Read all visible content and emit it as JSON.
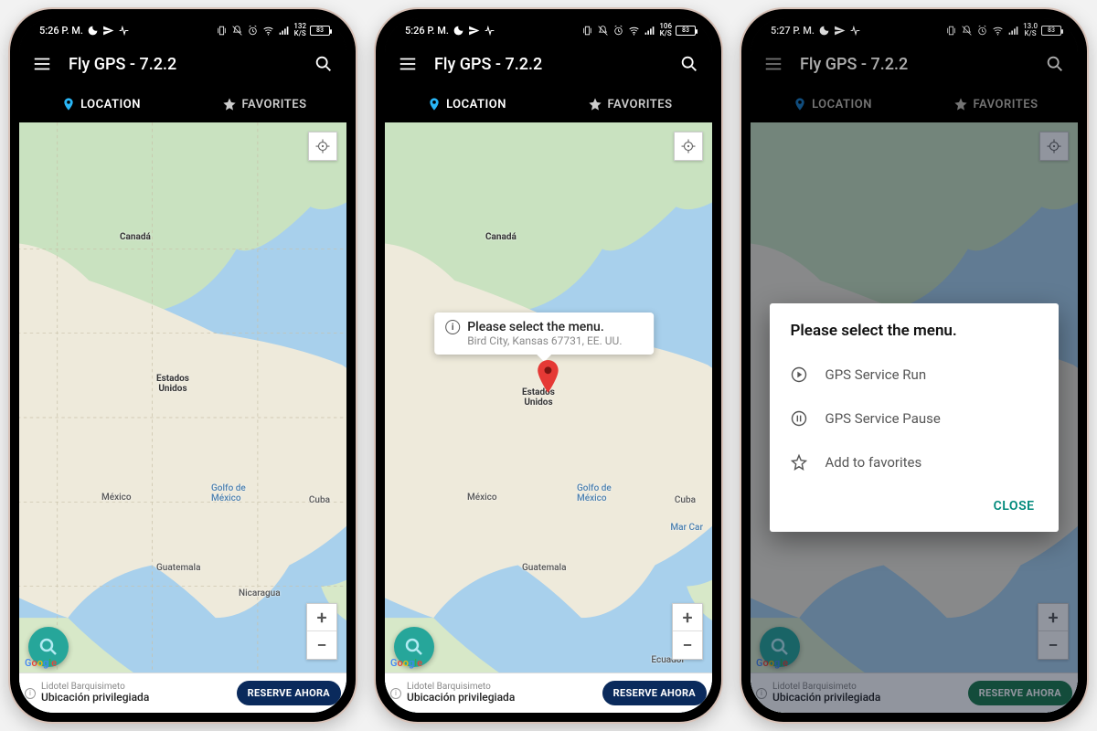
{
  "status": {
    "time_a": "5:26 P. M.",
    "time_b": "5:26 P. M.",
    "time_c": "5:27 P. M.",
    "net_a": "132",
    "net_b": "106",
    "net_c": "13.0",
    "net_unit": "K/S",
    "battery": "83"
  },
  "app": {
    "title": "Fly GPS - 7.2.2"
  },
  "tabs": {
    "location": "LOCATION",
    "favorites": "FAVORITES"
  },
  "mapLabels": {
    "canada": "Canadá",
    "usa": "Estados\nUnidos",
    "mexico": "México",
    "golfo": "Golfo de\nMéxico",
    "cuba": "Cuba",
    "guatemala": "Guatemala",
    "nicaragua": "Nicaragua",
    "ecuador": "Ecuador",
    "marcar": "Mar Car"
  },
  "tooltip": {
    "title": "Please select the menu.",
    "subtitle": "Bird City, Kansas 67731, EE. UU."
  },
  "dialog": {
    "title": "Please select the menu.",
    "opt1": "GPS Service Run",
    "opt2": "GPS Service Pause",
    "opt3": "Add to favorites",
    "close": "CLOSE"
  },
  "ad": {
    "line1": "Lidotel Barquisimeto",
    "line2": "Ubicación privilegiada",
    "cta": "RESERVE AHORA"
  },
  "zoom": {
    "in": "+",
    "out": "−"
  }
}
